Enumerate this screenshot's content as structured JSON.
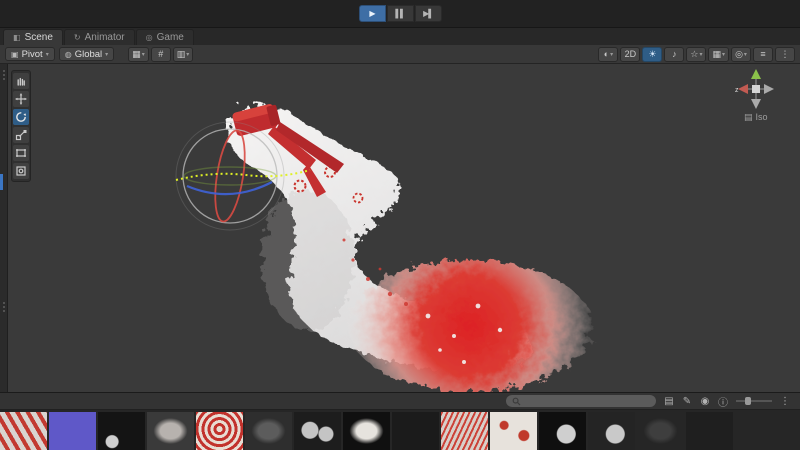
{
  "playback": {
    "play": "▶",
    "pause": "▌▌",
    "step": "▶▌"
  },
  "tabs": [
    {
      "name": "tab-scene",
      "icon": "◧",
      "label": "Scene",
      "active": true
    },
    {
      "name": "tab-animator",
      "icon": "↻",
      "label": "Animator"
    },
    {
      "name": "tab-game",
      "icon": "◎",
      "label": "Game"
    }
  ],
  "scene_toolbar": {
    "pivot_icon": "▣",
    "pivot_label": "Pivot",
    "global_icon": "◍",
    "global_label": "Global",
    "dropdown_arrow": "▾",
    "snap_icons": [
      {
        "name": "grid-visibility-icon",
        "glyph": "▦",
        "arrow": "▾"
      },
      {
        "name": "snap-increment-icon",
        "glyph": "#"
      },
      {
        "name": "grid-snapping-icon",
        "glyph": "▥",
        "arrow": "▾"
      }
    ],
    "right_icons": [
      {
        "name": "shaded-mode-icon",
        "glyph": "◐",
        "arrow": "▾"
      },
      {
        "name": "view-2d-icon",
        "glyph": "2D"
      },
      {
        "name": "lighting-icon",
        "glyph": "☀",
        "active": true
      },
      {
        "name": "audio-icon",
        "glyph": "♪"
      },
      {
        "name": "effects-icon",
        "glyph": "☆",
        "arrow": "▾"
      },
      {
        "name": "grid-icon",
        "glyph": "▦",
        "arrow": "▾"
      },
      {
        "name": "gizmos-icon",
        "glyph": "◎",
        "arrow": "▾"
      },
      {
        "name": "menu-icon",
        "glyph": "≡"
      },
      {
        "name": "more-icon",
        "glyph": "⋮"
      }
    ]
  },
  "tools": {
    "items": [
      "hand-tool",
      "move-tool",
      "rotate-tool",
      "scale-tool",
      "rect-tool",
      "transform-tool"
    ],
    "active": "rotate-tool"
  },
  "scene": {
    "iso_icon": "▤",
    "iso_label": "Iso",
    "axis_label": "z"
  },
  "project": {
    "search_placeholder": "",
    "icons": [
      {
        "name": "grid-view-icon",
        "glyph": "▤"
      },
      {
        "name": "edit-icon",
        "glyph": "✎"
      },
      {
        "name": "eye-icon",
        "glyph": "◉"
      },
      {
        "name": "info-icon",
        "glyph": "ⓘ"
      }
    ],
    "more_icon": "⋮",
    "thumbnails": [
      {
        "pattern": "stripes",
        "bg": "#d9d4d0",
        "accent": "#c23a31"
      },
      {
        "pattern": "solid",
        "bg": "#5f58c8"
      },
      {
        "pattern": "crescent",
        "bg": "#141414",
        "accent": "#cfcfcf"
      },
      {
        "pattern": "blob",
        "bg": "#3a3a3a",
        "accent": "#b7b2ae"
      },
      {
        "pattern": "rings",
        "bg": "#c2322c",
        "accent": "#e8ddd3"
      },
      {
        "pattern": "blob",
        "bg": "#2e2e2e",
        "accent": "#5c5c5c"
      },
      {
        "pattern": "spheres",
        "bg": "#1d1d1d",
        "accent": "#c4c4c4"
      },
      {
        "pattern": "blob",
        "bg": "#101010",
        "accent": "#e6e3de"
      },
      {
        "pattern": "solid",
        "bg": "#1b1b1b"
      },
      {
        "pattern": "fluff",
        "bg": "#d8cfc9",
        "accent": "#cc4238"
      },
      {
        "pattern": "dots",
        "bg": "#e7e2dc",
        "accent": "#c0392b"
      },
      {
        "pattern": "sphere",
        "bg": "#0f0f0f",
        "accent": "#cfcfcf"
      },
      {
        "pattern": "sphere",
        "bg": "#242424",
        "accent": "#c9c9c9"
      },
      {
        "pattern": "blob",
        "bg": "#262626",
        "accent": "#3e3e3e"
      },
      {
        "pattern": "solid",
        "bg": "#1f1f1f"
      }
    ]
  },
  "colors": {
    "accent_blue": "#3e6ea5",
    "selection_blue": "#3b76c4",
    "viewport_bg": "#3a3a3a",
    "tail_white": "#efeeec",
    "tail_red": "#dd2a26",
    "gizmo_yellow": "#dff024"
  }
}
